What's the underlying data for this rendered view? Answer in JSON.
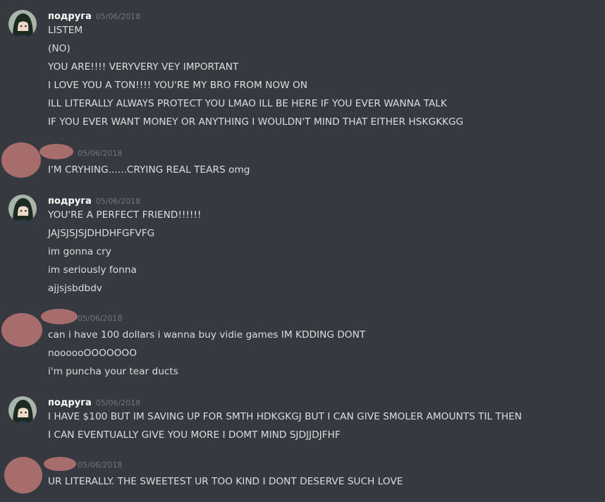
{
  "messages": [
    {
      "username": "подруга",
      "timestamp": "05/06/2018",
      "lines": [
        "LISTEM",
        "(NO)",
        "YOU ARE!!!! VERYVERY VEY IMPORTANT",
        "I LOVE YOU A TON!!!! YOU'RE MY BRO FROM NOW ON",
        "ILL LITERALLY ALWAYS PROTECT YOU LMAO ILL BE HERE IF YOU EVER WANNA TALK",
        "IF YOU EVER WANT MONEY OR ANYTHING I WOULDN'T MIND THAT EITHER HSKGKKGG"
      ]
    },
    {
      "username": "",
      "timestamp": "05/06/2018",
      "lines": [
        "I'M CRYHING......CRYING REAL TEARS omg"
      ]
    },
    {
      "username": "подруга",
      "timestamp": "05/06/2018",
      "lines": [
        "YOU'RE A PERFECT FRIEND!!!!!!",
        "JAJSJSJSJDHDHFGFVFG",
        "im gonna cry",
        "im seriously fonna",
        "ajjsjsbdbdv"
      ]
    },
    {
      "username": "",
      "timestamp": "05/06/2018",
      "lines": [
        "can i have 100 dollars i wanna buy vidie games IM KDDING DONT",
        "noooooOOOOOOO",
        "i'm puncha your tear ducts"
      ]
    },
    {
      "username": "подруга",
      "timestamp": "05/06/2018",
      "lines": [
        "I HAVE $100 BUT IM SAVING UP FOR SMTH HDKGKGJ BUT I CAN GIVE SMOLER AMOUNTS TIL THEN",
        "I CAN EVENTUALLY GIVE YOU MORE I DOMT MIND SJDJJDJFHF"
      ]
    },
    {
      "username": "",
      "timestamp": "05/06/2018",
      "lines": [
        "UR LITERALLY. THE SWEETEST UR TOO KIND I DONT DESERVE SUCH LOVE"
      ]
    }
  ],
  "colors": {
    "background": "#36393f",
    "username": "#ffffff",
    "timestamp": "#72767d",
    "message_text": "#dcddde",
    "redaction_blot": "#a76d6d"
  },
  "icons": {
    "friend_avatar": "anime-character-avatar-icon",
    "redacted_avatar": "redaction-blot"
  }
}
